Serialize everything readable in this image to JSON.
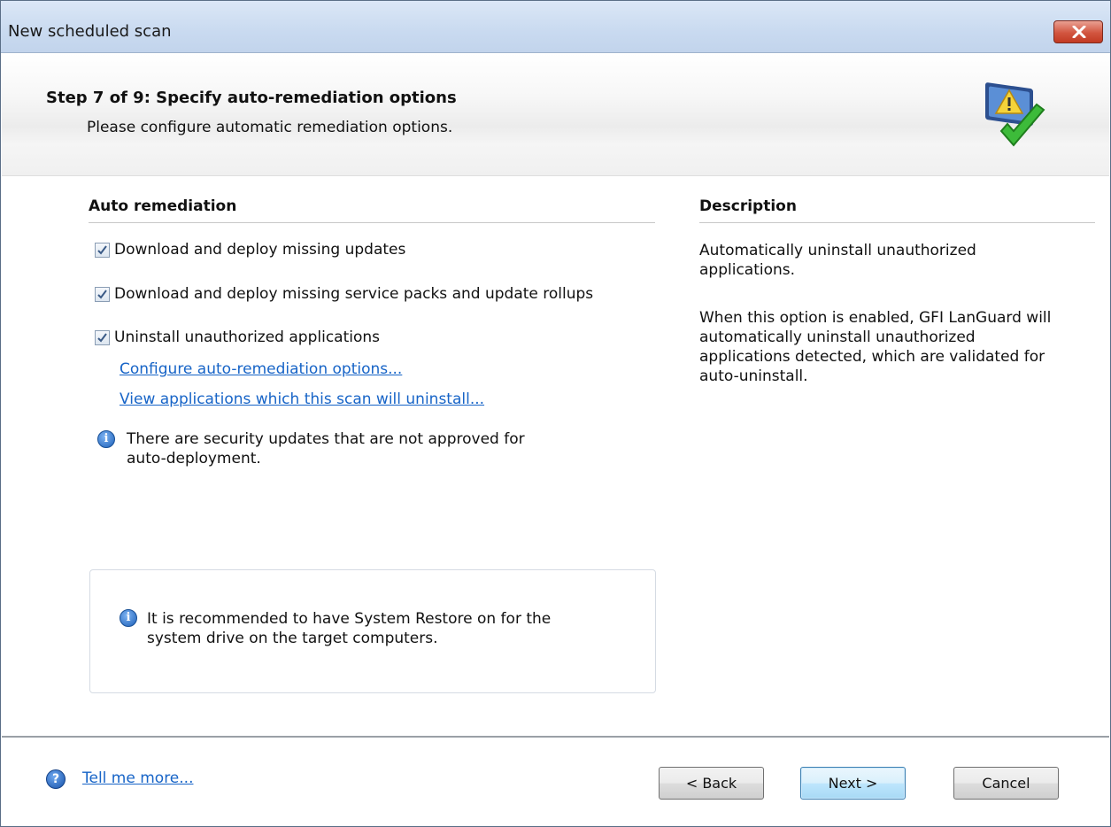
{
  "window": {
    "title": "New scheduled scan",
    "close_icon": "close-icon"
  },
  "header": {
    "step_title": "Step 7 of 9: Specify auto-remediation options",
    "step_subtitle": "Please configure automatic remediation options.",
    "icon": "warning-monitor-check-icon"
  },
  "remediation": {
    "heading": "Auto remediation",
    "options": [
      {
        "label": "Download and deploy missing updates",
        "checked": true
      },
      {
        "label": "Download and deploy missing service packs and update rollups",
        "checked": true
      },
      {
        "label": "Uninstall unauthorized applications",
        "checked": true
      }
    ],
    "links": {
      "configure": "Configure auto-remediation options...",
      "view_apps": "View applications which this scan will uninstall..."
    },
    "notice": {
      "line1": "There are security updates that are not approved for",
      "line2": "auto-deployment."
    },
    "restore_note": {
      "line1": "It is recommended to have System Restore on for the",
      "line2": "system drive on the target computers."
    }
  },
  "description": {
    "heading": "Description",
    "p1_line1": "Automatically uninstall unauthorized",
    "p1_line2": "applications.",
    "p2_line1": "When this option is enabled, GFI LanGuard will",
    "p2_line2": "automatically uninstall unauthorized",
    "p2_line3": "applications detected, which are validated for",
    "p2_line4": "auto-uninstall."
  },
  "footer": {
    "help_link": "Tell me more...",
    "back_label": "< Back",
    "next_label": "Next >",
    "cancel_label": "Cancel"
  },
  "colors": {
    "link": "#1764c7",
    "primary_button": "#bee6fd",
    "close_button": "#d2553f"
  }
}
